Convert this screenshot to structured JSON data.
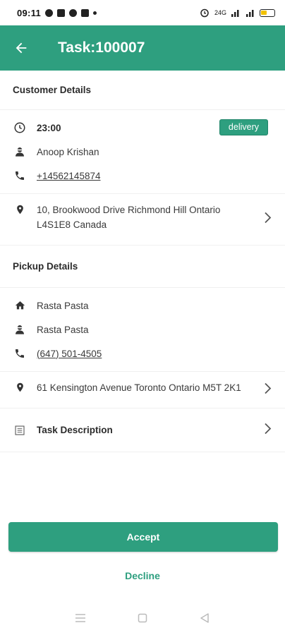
{
  "status_bar": {
    "time": "09:11",
    "network_label": "24G"
  },
  "header": {
    "title": "Task:100007"
  },
  "customer": {
    "section_title": "Customer Details",
    "time": "23:00",
    "badge": "delivery",
    "name": "Anoop Krishan",
    "phone": "+14562145874",
    "address": "10, Brookwood Drive Richmond Hill Ontario L4S1E8 Canada"
  },
  "pickup": {
    "section_title": "Pickup Details",
    "store": "Rasta Pasta",
    "contact": "Rasta Pasta",
    "phone": "(647) 501-4505",
    "address": "61 Kensington Avenue Toronto Ontario M5T 2K1"
  },
  "task_description": {
    "label": "Task Description"
  },
  "actions": {
    "accept_label": "Accept",
    "decline_label": "Decline"
  },
  "colors": {
    "primary": "#2e9f7f",
    "badge": "#2e9f7f",
    "text": "#3a3a3a"
  },
  "icons": {
    "back": "arrow-left-icon",
    "time": "clock-icon",
    "person": "person-icon",
    "phone": "phone-icon",
    "location": "location-pin-icon",
    "home": "home-icon",
    "description": "list-icon",
    "chevron": "chevron-right-icon"
  }
}
